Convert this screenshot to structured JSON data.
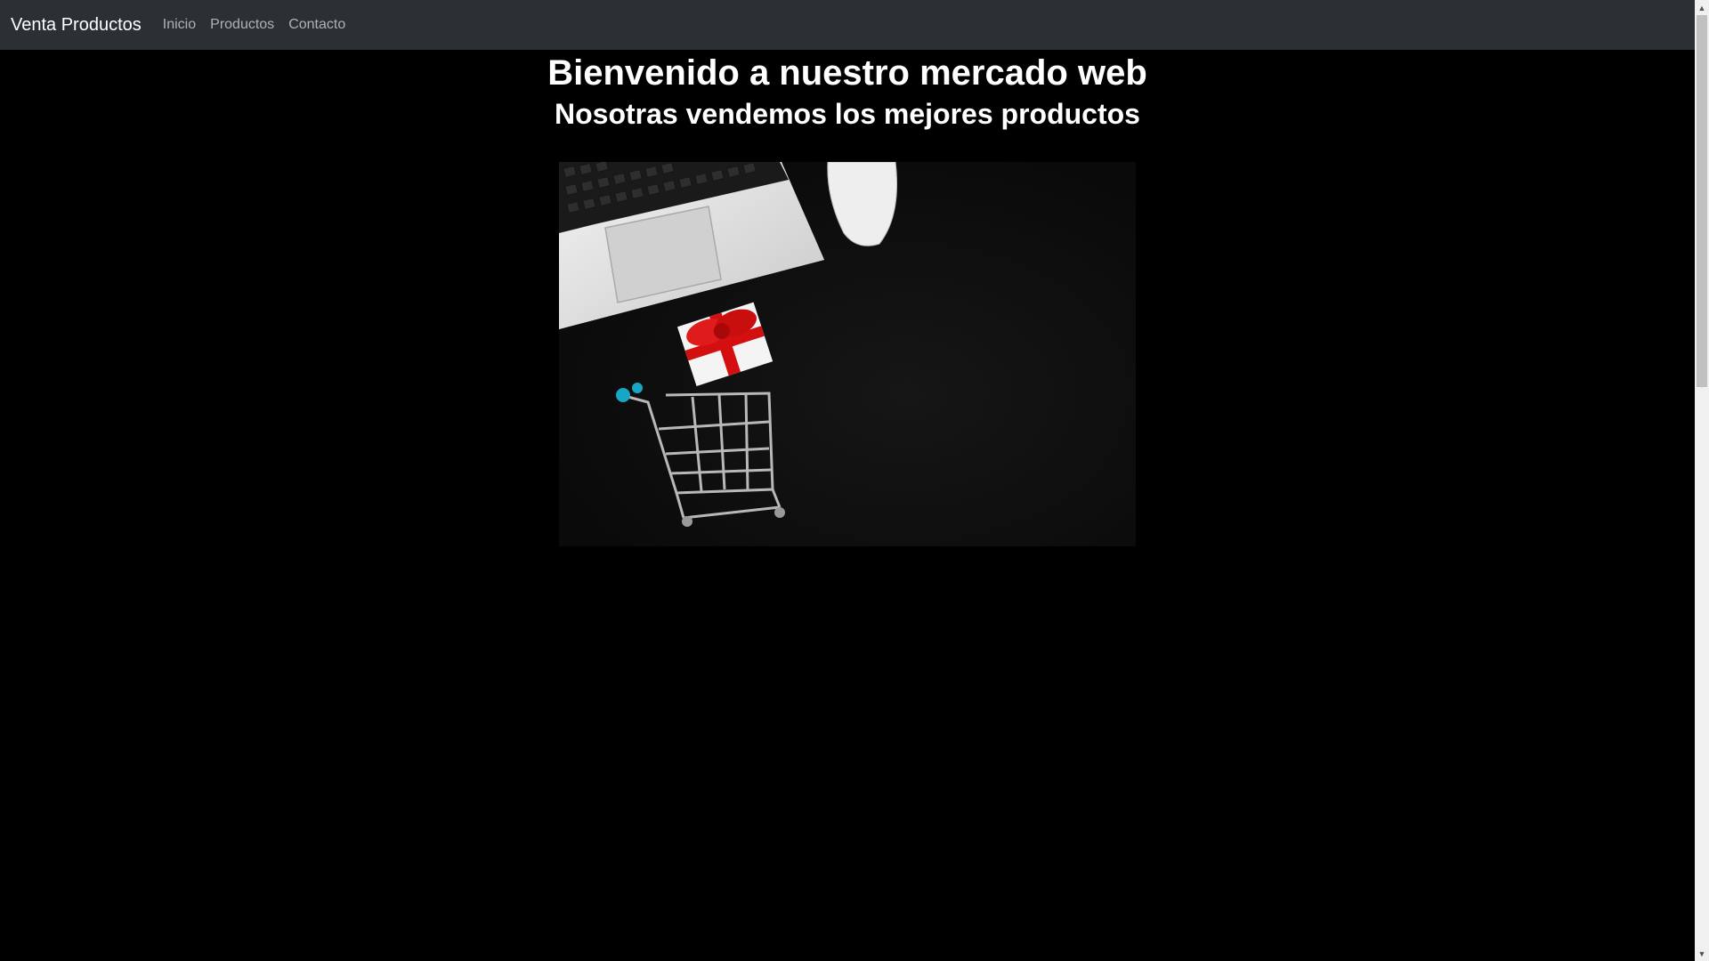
{
  "navbar": {
    "brand": "Venta Productos",
    "links": [
      "Inicio",
      "Productos",
      "Contacto"
    ]
  },
  "main": {
    "title": "Bienvenido a nuestro mercado web",
    "subtitle": "Nosotras vendemos los mejores productos"
  },
  "hero_image": {
    "description_icon": "laptop-cart-gift-image"
  },
  "scrollbar": {
    "up_glyph": "▲",
    "down_glyph": "▼"
  },
  "colors": {
    "navbar_bg": "#2b3035",
    "page_bg": "#000000",
    "text": "#ffffff",
    "nav_link": "#9ea0a3"
  }
}
